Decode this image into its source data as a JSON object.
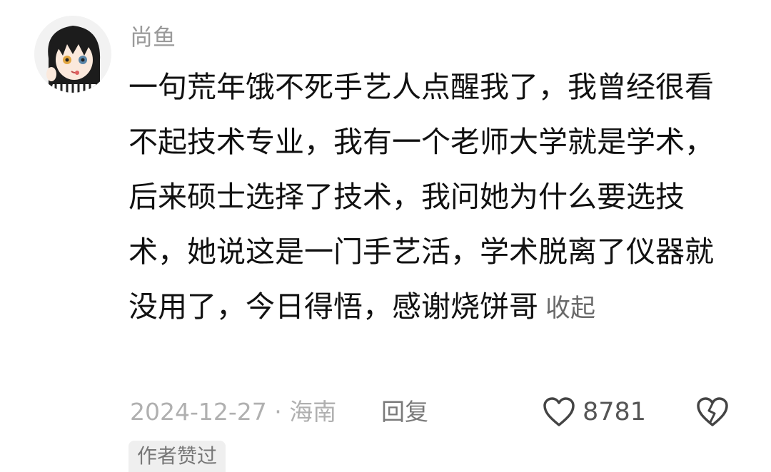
{
  "comment": {
    "username": "尚鱼",
    "text": "一句荒年饿不死手艺人点醒我了，我曾经很看不起技术专业，我有一个老师大学就是学术，后来硕士选择了技术，我问她为什么要选技术，她说这是一门手艺活，学术脱离了仪器就没用了，今日得悟，感谢烧饼哥",
    "collapse_label": "收起",
    "date_location": "2024-12-27 · 海南",
    "reply_label": "回复",
    "like_count": "8781",
    "author_badge": "作者赞过"
  },
  "icons": {
    "avatar": "anime-character-avatar",
    "like": "heart-outline-icon",
    "dislike": "broken-heart-icon"
  },
  "colors": {
    "username": "#9a9a9a",
    "text": "#111111",
    "meta": "#b0b0b0",
    "badge_bg": "#efefef"
  }
}
